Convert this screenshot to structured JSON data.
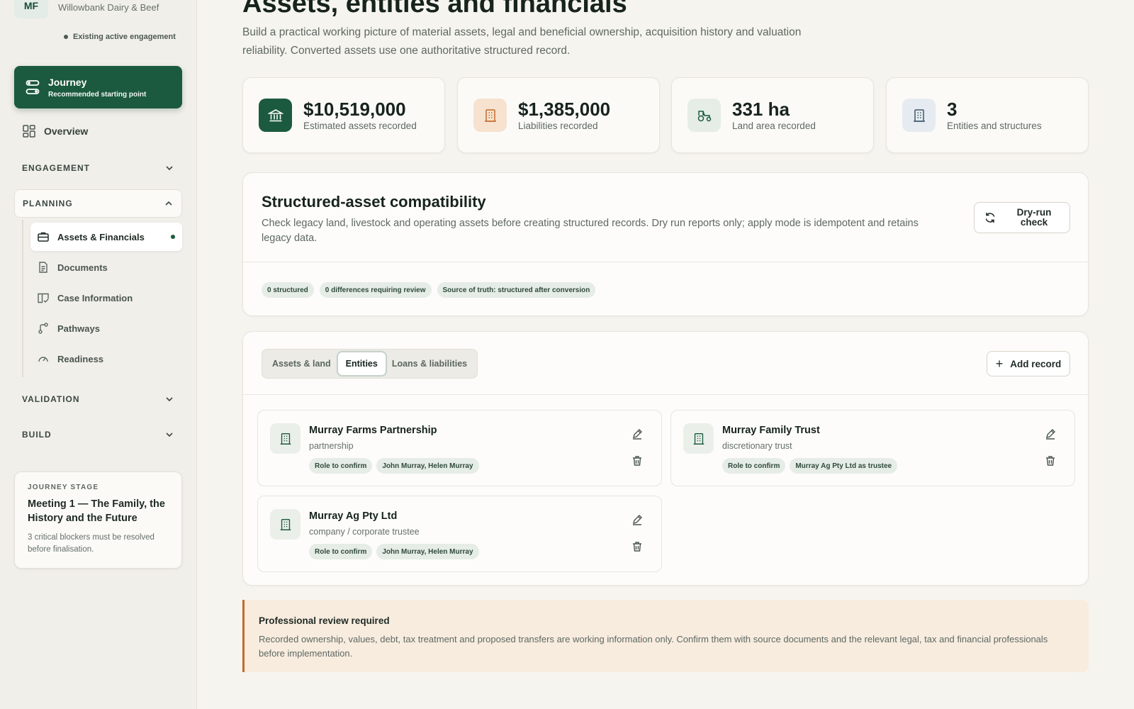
{
  "workspace": {
    "initials": "MF",
    "name": "Willowbank Dairy & Beef",
    "status": "Existing active engagement"
  },
  "sidebar": {
    "journey": {
      "title": "Journey",
      "subtitle": "Recommended starting point",
      "icon": "route-icon"
    },
    "overview": {
      "label": "Overview",
      "icon": "grid-icon"
    },
    "sections": [
      {
        "label": "ENGAGEMENT",
        "expanded": false
      },
      {
        "label": "PLANNING",
        "expanded": true
      },
      {
        "label": "VALIDATION",
        "expanded": false
      },
      {
        "label": "BUILD",
        "expanded": false
      }
    ],
    "planning_items": [
      {
        "label": "Assets & Financials",
        "icon": "briefcase-icon",
        "active": true
      },
      {
        "label": "Documents",
        "icon": "document-icon",
        "active": false
      },
      {
        "label": "Case Information",
        "icon": "book-check-icon",
        "active": false
      },
      {
        "label": "Pathways",
        "icon": "branch-icon",
        "active": false
      },
      {
        "label": "Readiness",
        "icon": "gauge-icon",
        "active": false
      }
    ],
    "stage_card": {
      "kicker": "JOURNEY STAGE",
      "title": "Meeting 1 — The Family, the History and the Future",
      "text": "3 critical blockers must be resolved before finalisation."
    }
  },
  "page": {
    "title": "Assets, entities and financials",
    "description": "Build a practical working picture of material assets, legal and beneficial ownership, acquisition history and valuation reliability. Converted assets use one authoritative structured record."
  },
  "stats": [
    {
      "value": "$10,519,000",
      "label": "Estimated assets recorded",
      "icon": "bank-icon",
      "color": "#1b5a3e"
    },
    {
      "value": "$1,385,000",
      "label": "Liabilities recorded",
      "icon": "building-icon",
      "color": "#f6e2cf"
    },
    {
      "value": "331 ha",
      "label": "Land area recorded",
      "icon": "tractor-icon",
      "color": "#e6ece6"
    },
    {
      "value": "3",
      "label": "Entities and structures",
      "icon": "building-icon",
      "color": "#e5ebf1"
    }
  ],
  "compatibility": {
    "title": "Structured-asset compatibility",
    "description": "Check legacy land, livestock and operating assets before creating structured records. Dry run reports only; apply mode is idempotent and retains legacy data.",
    "button_label": "Dry-run check",
    "chips": [
      "0 structured",
      "0 differences requiring review",
      "Source of truth: structured after conversion"
    ]
  },
  "records": {
    "tabs": [
      "Assets & land",
      "Entities",
      "Loans & liabilities"
    ],
    "active_tab": "Entities",
    "add_label": "Add record",
    "entities": [
      {
        "name": "Murray Farms Partnership",
        "type": "partnership",
        "chips": [
          "Role to confirm",
          "John Murray, Helen Murray"
        ]
      },
      {
        "name": "Murray Family Trust",
        "type": "discretionary trust",
        "chips": [
          "Role to confirm",
          "Murray Ag Pty Ltd as trustee"
        ]
      },
      {
        "name": "Murray Ag Pty Ltd",
        "type": "company / corporate trustee",
        "chips": [
          "Role to confirm",
          "John Murray, Helen Murray"
        ]
      }
    ]
  },
  "review": {
    "title": "Professional review required",
    "text": "Recorded ownership, values, debt, tax treatment and proposed transfers are working information only. Confirm them with source documents and the relevant legal, tax and financial professionals before implementation."
  },
  "colors": {
    "brand": "#1b5a3e",
    "warning_bg": "#f8ecdf",
    "warning_border": "#c46a2c"
  }
}
